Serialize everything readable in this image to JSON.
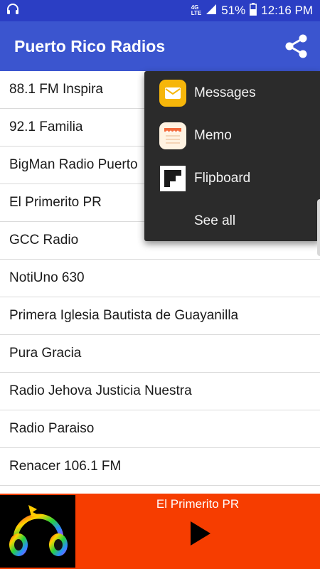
{
  "status_bar": {
    "network_top": "4G",
    "network_bottom": "LTE",
    "battery": "51%",
    "time": "12:16 PM",
    "icons": [
      "headset-icon",
      "signal-icon",
      "battery-icon"
    ]
  },
  "app_bar": {
    "title": "Puerto Rico Radios",
    "share_icon": "share-icon"
  },
  "stations": [
    "88.1 FM Inspira",
    "92.1 Familia",
    "BigMan Radio Puerto",
    "El Primerito PR",
    "GCC Radio",
    "NotiUno 630",
    "Primera Iglesia Bautista de Guayanilla",
    "Pura Gracia",
    "Radio Jehova Justicia Nuestra",
    "Radio Paraiso",
    "Renacer 106.1 FM"
  ],
  "share_menu": {
    "items": [
      {
        "label": "Messages",
        "icon": "messages-icon"
      },
      {
        "label": "Memo",
        "icon": "memo-icon"
      },
      {
        "label": "Flipboard",
        "icon": "flipboard-icon"
      },
      {
        "label": "See all",
        "icon": ""
      }
    ]
  },
  "player": {
    "now_playing": "El Primerito PR",
    "play_icon": "play-icon",
    "accent_color": "#f63d00"
  },
  "colors": {
    "status_bar": "#2b3ec4",
    "app_bar": "#3b55cf",
    "popup": "#2b2b2b"
  }
}
